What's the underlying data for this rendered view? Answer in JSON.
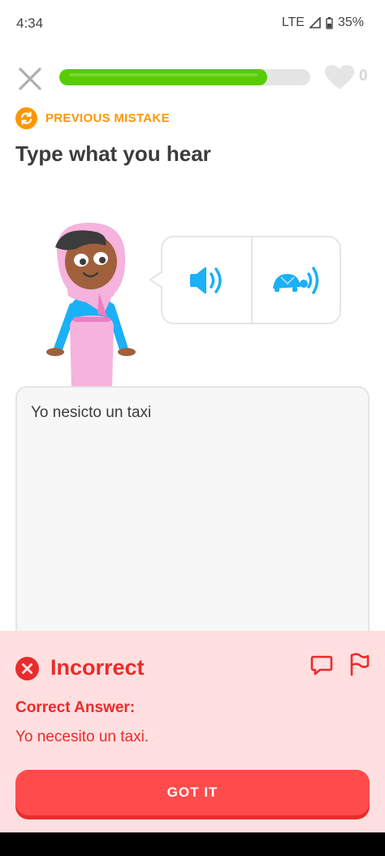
{
  "status_bar": {
    "time": "4:34",
    "network": "LTE",
    "battery": "35%"
  },
  "lesson": {
    "progress_percent": 83,
    "hearts": "0"
  },
  "icons": {
    "close": "close-icon",
    "heart": "heart-icon",
    "mistake": "repeat-icon",
    "speaker": "speaker-icon",
    "slow": "turtle-speaker-icon",
    "incorrect": "x-circle-icon",
    "comment": "comment-icon",
    "flag": "flag-icon"
  },
  "header": {
    "mistake_label": "PREVIOUS MISTAKE",
    "title": "Type what you hear"
  },
  "answer": {
    "value": "Yo nesicto un taxi"
  },
  "feedback": {
    "status": "Incorrect",
    "correct_label": "Correct Answer:",
    "correct_answer": "Yo necesito un taxi.",
    "button": "GOT IT"
  },
  "colors": {
    "accent_green": "#58cc02",
    "orange": "#ff9600",
    "blue": "#1cb0f6",
    "error_red": "#ea2b2b",
    "error_bg": "#ffdfe0",
    "button_red": "#ff4b4b"
  }
}
